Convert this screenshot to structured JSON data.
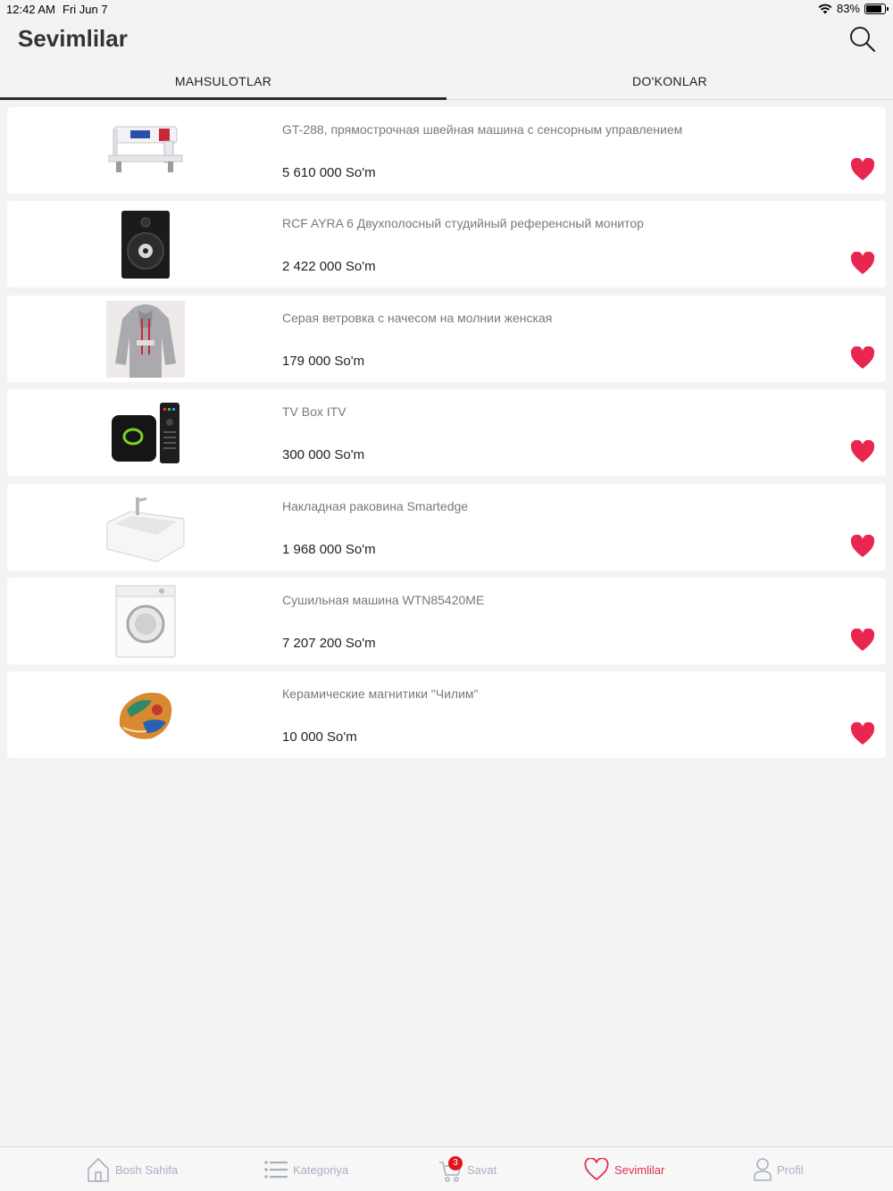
{
  "status_bar": {
    "time": "12:42 AM",
    "date": "Fri Jun 7",
    "battery": "83%",
    "battery_level": 0.83
  },
  "header": {
    "title": "Sevimlilar",
    "search_icon": "search-icon"
  },
  "tabs": [
    {
      "label": "MAHSULOTLAR",
      "active": true
    },
    {
      "label": "DO'KONLAR",
      "active": false
    }
  ],
  "products": [
    {
      "title": "GT-288, прямострочная швейная машина с сенсорным управлением",
      "price": "5 610 000 So'm",
      "icon": "sewing-machine-image"
    },
    {
      "title": "RCF AYRA 6 Двухполосный студийный референсный монитор",
      "price": "2 422 000 So'm",
      "icon": "speaker-image"
    },
    {
      "title": "Серая ветровка с начесом на молнии женская",
      "price": "179 000 So'm",
      "icon": "hoodie-image"
    },
    {
      "title": "TV Box ITV",
      "price": "300 000 So'm",
      "icon": "tv-box-image"
    },
    {
      "title": "Накладная раковина Smartedge",
      "price": "1 968 000 So'm",
      "icon": "sink-image"
    },
    {
      "title": "Сушильная машина WTN85420ME",
      "price": "7 207 200 So'm",
      "icon": "dryer-image"
    },
    {
      "title": "Керамические магнитики \"Чилим\"",
      "price": "10 000 So'm",
      "icon": "magnet-image"
    }
  ],
  "bottom_nav": [
    {
      "label": "Bosh Sahifa",
      "icon": "home-icon"
    },
    {
      "label": "Kategoriya",
      "icon": "list-icon"
    },
    {
      "label": "Savat",
      "icon": "cart-icon",
      "badge": "3"
    },
    {
      "label": "Sevimlilar",
      "icon": "heart-icon",
      "active": true
    },
    {
      "label": "Profil",
      "icon": "user-icon"
    }
  ],
  "colors": {
    "accent": "#e0304f",
    "heart": "#e8264f",
    "background": "#f4f3f2",
    "inactive_nav": "#a8b0c0"
  }
}
